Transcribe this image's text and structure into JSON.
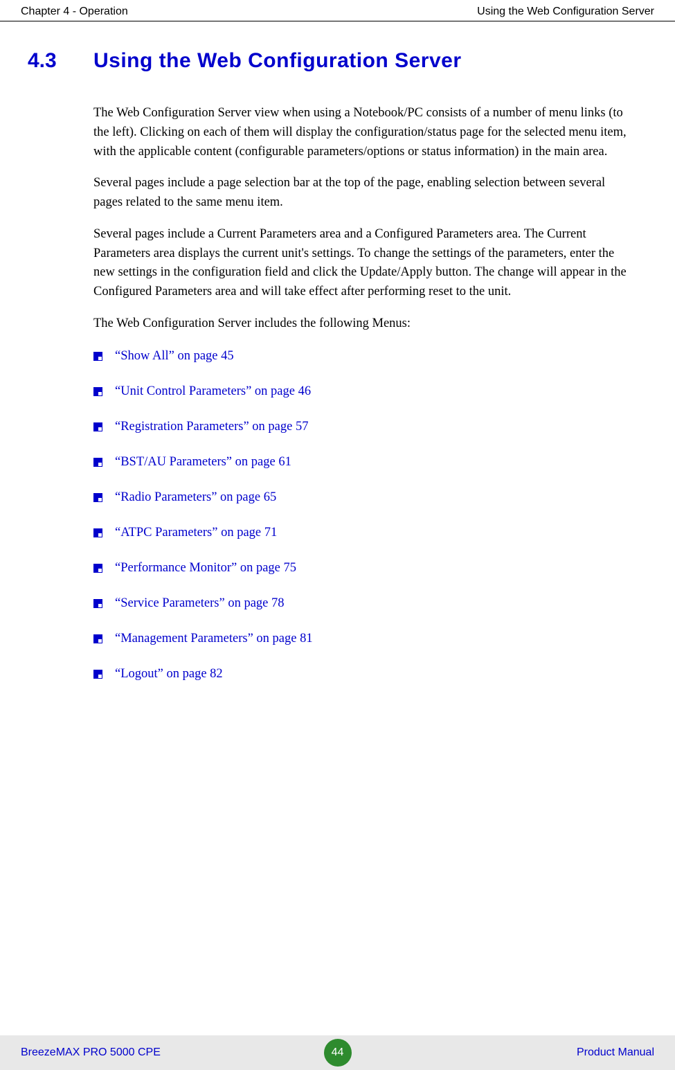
{
  "header": {
    "left": "Chapter 4 - Operation",
    "right": "Using the Web Configuration Server"
  },
  "section": {
    "number": "4.3",
    "title": "Using the Web Configuration Server"
  },
  "paragraphs": {
    "p1": "The Web Configuration Server view when using a Notebook/PC consists of a number of menu links (to the left). Clicking on each of them will display the configuration/status page for the selected menu item, with the applicable content (configurable parameters/options or status information) in the main area.",
    "p2": "Several pages include a page selection bar at the top of the page, enabling selection between several pages related to the same menu item.",
    "p3": "Several pages include a Current Parameters area and a Configured Parameters area. The Current Parameters area displays the current unit's settings. To change the settings of the parameters, enter the new settings in the configuration field and click the Update/Apply button. The change will appear in the Configured Parameters area and will take effect after performing reset to the unit.",
    "p4": "The Web Configuration Server includes the following Menus:"
  },
  "menus": [
    {
      "label": "“Show All” on page 45"
    },
    {
      "label": "“Unit Control Parameters” on page 46"
    },
    {
      "label": "“Registration Parameters” on page 57"
    },
    {
      "label": "“BST/AU Parameters” on page 61"
    },
    {
      "label": "“Radio Parameters” on page 65"
    },
    {
      "label": "“ATPC Parameters” on page 71"
    },
    {
      "label": "“Performance Monitor” on page 75"
    },
    {
      "label": "“Service Parameters” on page 78"
    },
    {
      "label": "“Management Parameters” on page 81"
    },
    {
      "label": "“Logout” on page 82"
    }
  ],
  "footer": {
    "left": "BreezeMAX PRO 5000 CPE",
    "page": "44",
    "right": "Product Manual"
  }
}
